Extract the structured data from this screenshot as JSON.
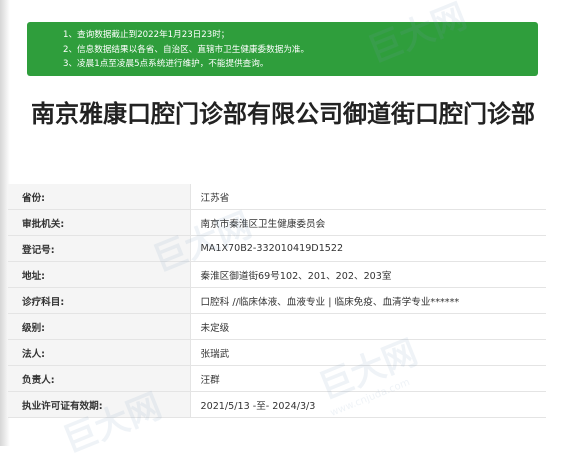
{
  "notice": {
    "lines": [
      "1、查询数据截止到2022年1月23日23时；",
      "2、信息数据结果以各省、自治区、直辖市卫生健康委数据为准。",
      "3、凌晨1点至凌晨5点系统进行维护，不能提供查询。"
    ]
  },
  "title": "南京雅康口腔门诊部有限公司御道街口腔门诊部",
  "rows": [
    {
      "label": "省份:",
      "value": "江苏省"
    },
    {
      "label": "审批机关:",
      "value": "南京市秦淮区卫生健康委员会"
    },
    {
      "label": "登记号:",
      "value": "MA1X70B2-332010419D1522"
    },
    {
      "label": "地址:",
      "value": "秦淮区御道街69号102、201、202、203室"
    },
    {
      "label": "诊疗科目:",
      "value": "口腔科 //临床体液、血液专业 | 临床免疫、血清学专业******"
    },
    {
      "label": "级别:",
      "value": "未定级"
    },
    {
      "label": "法人:",
      "value": "张瑞武"
    },
    {
      "label": "负责人:",
      "value": "汪群"
    },
    {
      "label": "执业许可证有效期:",
      "value": "2021/5/13 -至- 2024/3/3"
    }
  ],
  "watermark": {
    "text": "巨大网",
    "url": "www.cnjuda.com"
  }
}
